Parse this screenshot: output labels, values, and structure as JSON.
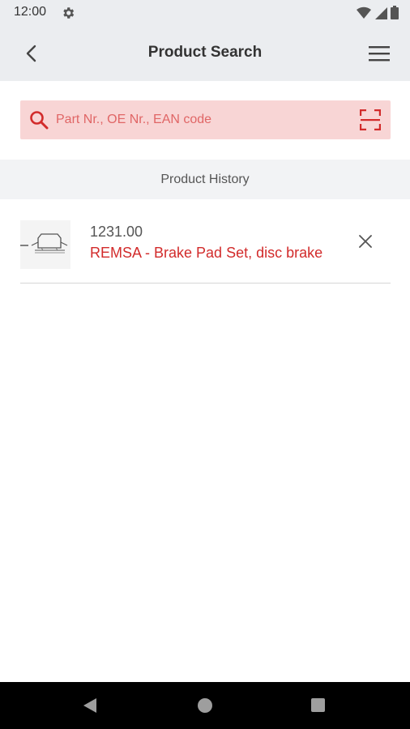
{
  "status_bar": {
    "time": "12:00"
  },
  "app_bar": {
    "title": "Product Search"
  },
  "search": {
    "placeholder": "Part Nr., OE Nr., EAN code",
    "value": ""
  },
  "history": {
    "header": "Product History",
    "items": [
      {
        "number": "1231.00",
        "title": "REMSA - Brake Pad Set, disc brake",
        "thumbnail_icon": "brake-pad-icon"
      }
    ]
  },
  "colors": {
    "accent": "#d22b2b",
    "search_bg": "#f8d5d5",
    "app_bar_bg": "#ebedf0"
  }
}
